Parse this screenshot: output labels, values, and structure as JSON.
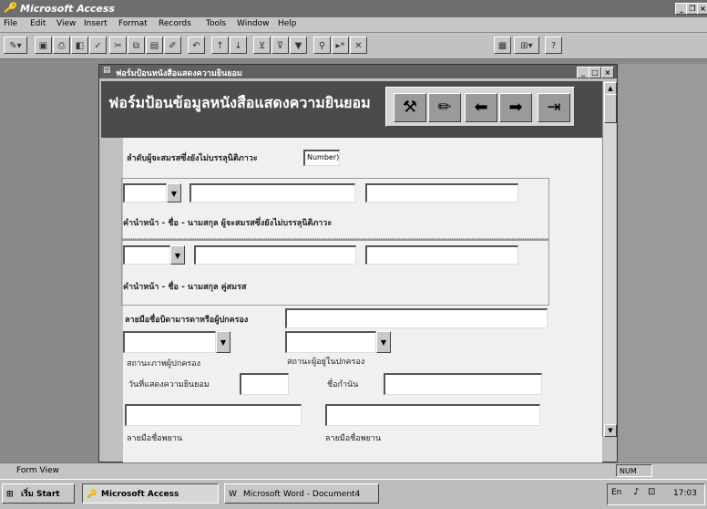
{
  "app": {
    "title": "Microsoft Access",
    "menus": [
      "File",
      "Edit",
      "View",
      "Insert",
      "Format",
      "Records",
      "Tools",
      "Window",
      "Help"
    ]
  },
  "form": {
    "window_title": "ฟอร์มป้อนหนังสือแสดงความยินยอม",
    "header_title": "ฟอร์มป้อนข้อมูลหนังสือแสดงความยินยอม",
    "seq_label": "ลำดับผู้จะสมรสซึ่งยังไม่บรรลุนิติภาวะ",
    "seq_value": "Number)",
    "person_label": "คำนำหน้า - ชื่อ - นามสกุล ผู้จะสมรสซึ่งยังไม่บรรลุนิติภาวะ",
    "spouse_label": "คำนำหน้า - ชื่อ - นามสกุล คู่สมรส",
    "guardian_sign_label": "ลายมือชื่อบิดามารดาหรือผู้ปกครอง",
    "guardian_status_label": "สถานะภาพผู้ปกครอง",
    "custody_status_label": "สถานะผู้อยู่ในปกครอง",
    "consent_date_label": "วันที่แสดงความยินยอม",
    "place_label": "ชื่อกำนัน",
    "witness1_label": "ลายมือชื่อพยาน",
    "witness2_label": "ลายมือชื่อพยาน"
  },
  "status": {
    "view": "Form View",
    "num": "NUM"
  },
  "taskbar": {
    "start": "เริ่ม Start",
    "tasks": [
      "Microsoft Access",
      "Microsoft Word - Document4"
    ],
    "clock": "17:03"
  }
}
